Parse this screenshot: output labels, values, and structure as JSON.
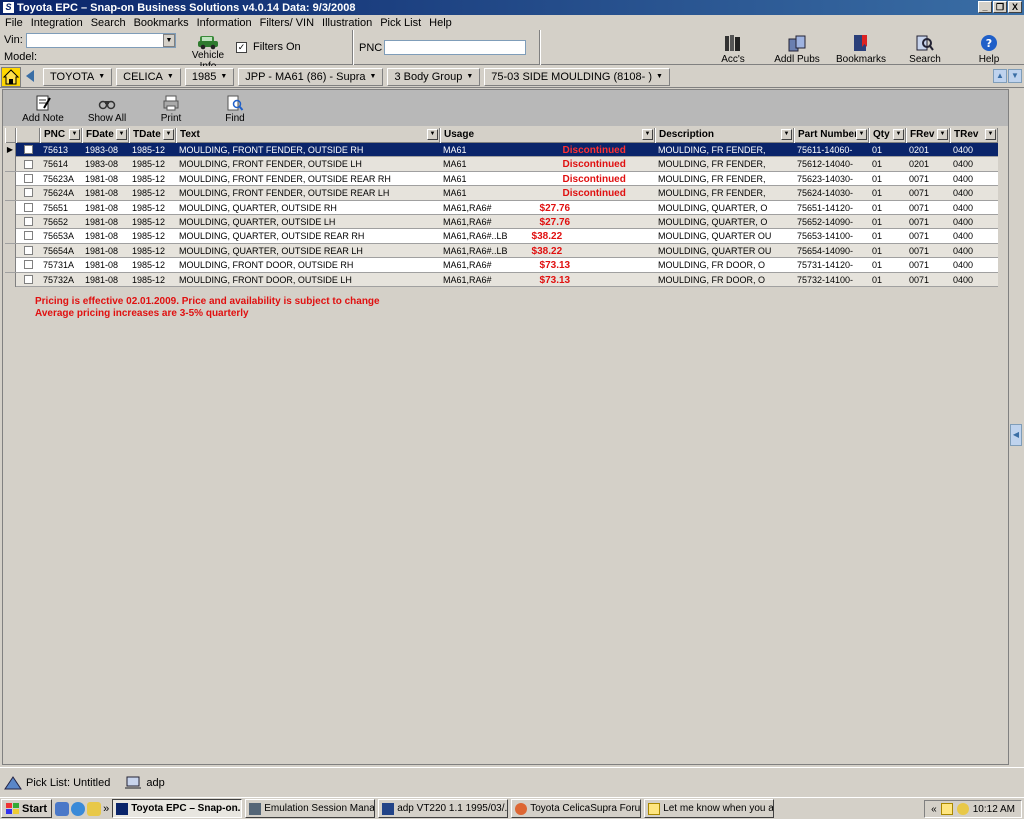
{
  "window": {
    "title": "Toyota EPC – Snap-on Business Solutions   v4.0.14   Data: 9/3/2008",
    "app_glyph": "S",
    "minimize": "_",
    "restore": "❐",
    "close": "X"
  },
  "menu": [
    "File",
    "Integration",
    "Search",
    "Bookmarks",
    "Information",
    "Filters/ VIN",
    "Illustration",
    "Pick List",
    "Help"
  ],
  "toolbar": {
    "vin_label": "Vin:",
    "vin_value": "",
    "model_label": "Model:",
    "vehicle_info": "Vehicle Info",
    "filters_on": "Filters On",
    "filters_checked": "✓",
    "pnc_label": "PNC",
    "pnc_value": "",
    "tools": [
      {
        "label": "Acc's",
        "icon": "books-icon"
      },
      {
        "label": "Addl Pubs",
        "icon": "pubs-icon"
      },
      {
        "label": "Bookmarks",
        "icon": "bookmarks-icon"
      },
      {
        "label": "Search",
        "icon": "search-icon"
      },
      {
        "label": "Help",
        "icon": "help-icon"
      }
    ]
  },
  "breadcrumbs": [
    "TOYOTA",
    "CELICA",
    "1985",
    "JPP - MA61 (86) - Supra",
    "3  Body Group",
    "75-03  SIDE MOULDING  (8108-  )"
  ],
  "panel_tools": [
    "Add Note",
    "Show All",
    "Print",
    "Find"
  ],
  "grid": {
    "columns": [
      "PNC",
      "FDate",
      "TDate",
      "Text",
      "Usage",
      "Description",
      "Part Number",
      "Qty",
      "FRev",
      "TRev"
    ],
    "rows": [
      {
        "pnc": "75613",
        "fdate": "1983-08",
        "tdate": "1985-12",
        "text": "MOULDING, FRONT FENDER, OUTSIDE RH",
        "usage": "MA61",
        "status": "Discontinued",
        "description": "MOULDING, FR FENDER,",
        "part": "75611-14060-",
        "qty": "01",
        "frev": "0201",
        "trev": "0400"
      },
      {
        "pnc": "75614",
        "fdate": "1983-08",
        "tdate": "1985-12",
        "text": "MOULDING, FRONT FENDER, OUTSIDE LH",
        "usage": "MA61",
        "status": "Discontinued",
        "description": "MOULDING, FR FENDER,",
        "part": "75612-14040-",
        "qty": "01",
        "frev": "0201",
        "trev": "0400"
      },
      {
        "pnc": "75623A",
        "fdate": "1981-08",
        "tdate": "1985-12",
        "text": "MOULDING, FRONT FENDER, OUTSIDE REAR RH",
        "usage": "MA61",
        "status": "Discontinued",
        "description": "MOULDING, FR FENDER,",
        "part": "75623-14030-",
        "qty": "01",
        "frev": "0071",
        "trev": "0400"
      },
      {
        "pnc": "75624A",
        "fdate": "1981-08",
        "tdate": "1985-12",
        "text": "MOULDING, FRONT FENDER, OUTSIDE REAR LH",
        "usage": "MA61",
        "status": "Discontinued",
        "description": "MOULDING, FR FENDER,",
        "part": "75624-14030-",
        "qty": "01",
        "frev": "0071",
        "trev": "0400"
      },
      {
        "pnc": "75651",
        "fdate": "1981-08",
        "tdate": "1985-12",
        "text": "MOULDING, QUARTER, OUTSIDE RH",
        "usage": "MA61,RA6#",
        "status": "$27.76",
        "description": "MOULDING, QUARTER, O",
        "part": "75651-14120-",
        "qty": "01",
        "frev": "0071",
        "trev": "0400"
      },
      {
        "pnc": "75652",
        "fdate": "1981-08",
        "tdate": "1985-12",
        "text": "MOULDING, QUARTER, OUTSIDE LH",
        "usage": "MA61,RA6#",
        "status": "$27.76",
        "description": "MOULDING, QUARTER, O",
        "part": "75652-14090-",
        "qty": "01",
        "frev": "0071",
        "trev": "0400"
      },
      {
        "pnc": "75653A",
        "fdate": "1981-08",
        "tdate": "1985-12",
        "text": "MOULDING, QUARTER, OUTSIDE REAR RH",
        "usage": "MA61,RA6#..LB",
        "status": "$38.22",
        "description": "MOULDING, QUARTER OU",
        "part": "75653-14100-",
        "qty": "01",
        "frev": "0071",
        "trev": "0400"
      },
      {
        "pnc": "75654A",
        "fdate": "1981-08",
        "tdate": "1985-12",
        "text": "MOULDING, QUARTER, OUTSIDE REAR LH",
        "usage": "MA61,RA6#..LB",
        "status": "$38.22",
        "description": "MOULDING, QUARTER OU",
        "part": "75654-14090-",
        "qty": "01",
        "frev": "0071",
        "trev": "0400"
      },
      {
        "pnc": "75731A",
        "fdate": "1981-08",
        "tdate": "1985-12",
        "text": "MOULDING, FRONT DOOR, OUTSIDE RH",
        "usage": "MA61,RA6#",
        "status": "$73.13",
        "description": "MOULDING, FR DOOR, O",
        "part": "75731-14120-",
        "qty": "01",
        "frev": "0071",
        "trev": "0400"
      },
      {
        "pnc": "75732A",
        "fdate": "1981-08",
        "tdate": "1985-12",
        "text": "MOULDING, FRONT DOOR, OUTSIDE LH",
        "usage": "MA61,RA6#",
        "status": "$73.13",
        "description": "MOULDING, FR DOOR, O",
        "part": "75732-14100-",
        "qty": "01",
        "frev": "0071",
        "trev": "0400"
      }
    ]
  },
  "notice": {
    "line1": "Pricing is effective 02.01.2009.  Price and availability is subject to change",
    "line2": "Average pricing increases are 3-5% quarterly"
  },
  "statusbar": {
    "picklist": "Pick List: Untitled",
    "user": "adp"
  },
  "taskbar": {
    "start": "Start",
    "overflow": "»",
    "tasks": [
      {
        "label": "Toyota EPC – Snap-on...",
        "active": true
      },
      {
        "label": "Emulation Session Manager",
        "active": false
      },
      {
        "label": "adp VT220 1.1 1995/03/...",
        "active": false
      },
      {
        "label": "Toyota CelicaSupra Foru...",
        "active": false
      },
      {
        "label": "Let me know when you a...",
        "active": false
      }
    ],
    "tray_expand": "«",
    "clock": "10:12 AM"
  },
  "colors": {
    "accent": "#0a246a",
    "status_red": "#e01010"
  }
}
